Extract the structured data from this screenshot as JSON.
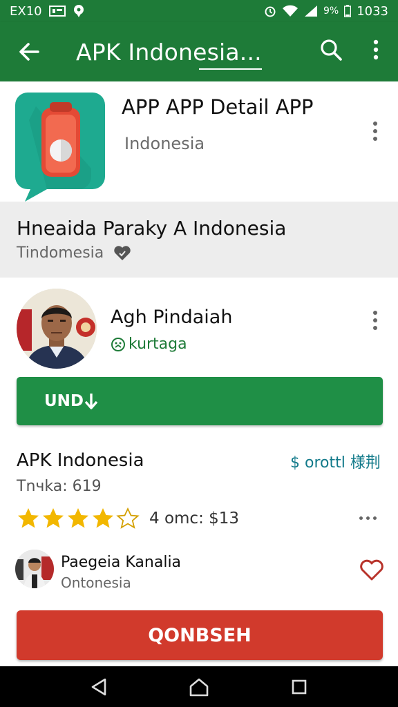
{
  "status_bar": {
    "carrier": "EX10",
    "battery_label": "9%",
    "time": "1033"
  },
  "app_bar": {
    "title": "APK Indonesia...",
    "icons": [
      "back-arrow-icon",
      "search-icon",
      "more-vert-icon"
    ]
  },
  "header": {
    "app_name": "APP APP Detail APP",
    "subtitle": "Indonesia"
  },
  "banner": {
    "heading": "Hneaida Paraky A Indonesia",
    "subtext": "Tindomesia"
  },
  "developer": {
    "name": "Agh Pindaiah",
    "tag": "kurtaga"
  },
  "install_button": {
    "label": "UND"
  },
  "info": {
    "apk_title": "APK Indonesia",
    "price_text": "$ orottl 様荆",
    "count_text": "Tnчka: 619",
    "rating_value": 4,
    "rating_max": 5,
    "rating_text": "4 omc: $13"
  },
  "uploader": {
    "name": "Paegeia Kanalia",
    "location": "Ontonesia"
  },
  "download_button": {
    "label": "QONBSEH"
  },
  "colors": {
    "primary_green": "#1e7b38",
    "install_green": "#1f8f46",
    "download_red": "#d13a2c",
    "star_yellow": "#f2b700",
    "app_icon_teal": "#1eaa90"
  }
}
